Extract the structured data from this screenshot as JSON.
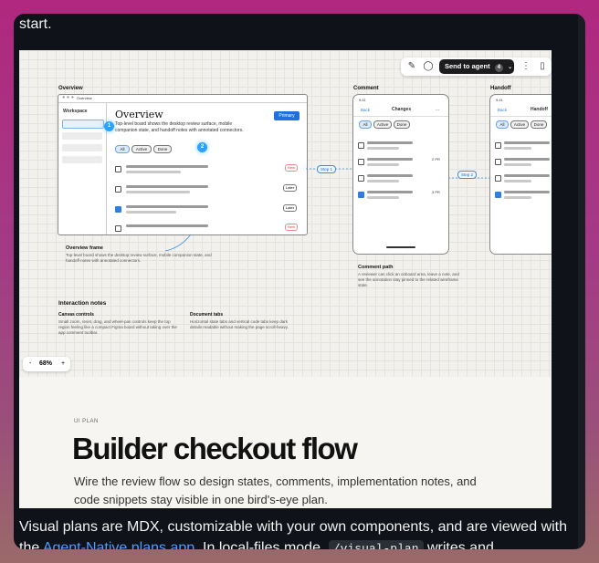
{
  "message": {
    "top_text": "start.",
    "bottom_text_1": "Visual plans are MDX, customizable with your own components, and are viewed",
    "bottom_text_2a": "with the ",
    "bottom_link": "Agent-Native plans app",
    "bottom_text_2b": ". In local-files mode, ",
    "bottom_code": "/visual-plan",
    "bottom_text_2c": " writes and"
  },
  "toolbar": {
    "send_label": "Send to agent",
    "send_count": "4",
    "icons": [
      "pen-icon",
      "comment-icon",
      "chevron-down-icon",
      "more-icon",
      "panel-icon"
    ]
  },
  "canvas": {
    "overview_label": "Overview",
    "comment_label": "Comment",
    "handoff_label": "Handoff",
    "overview_window": {
      "tab": "Overview",
      "sidebar_title": "Workspace",
      "heading": "Overview",
      "description": "Top-level board shows the desktop review surface, mobile companion state, and handoff notes with annotated connectors.",
      "button": "Primary",
      "filters": [
        "All",
        "Active",
        "Done"
      ],
      "row_tags": [
        "New",
        "Later",
        "Later",
        "New"
      ]
    },
    "markers": [
      "1",
      "2"
    ],
    "steps": [
      "Step 1",
      "Step 2"
    ],
    "phone_comment": {
      "time": "9:41",
      "back": "Back",
      "title": "Changes",
      "more": "...",
      "filters": [
        "All",
        "Active",
        "Done"
      ],
      "row_meta": [
        "",
        "2 PR",
        "",
        "3 PR"
      ]
    },
    "phone_handoff": {
      "time": "9:41",
      "back": "Back",
      "title": "Handoff",
      "filters": [
        "All",
        "Active",
        "Done"
      ]
    },
    "overview_frame": {
      "title": "Overview frame",
      "body": "Top-level board shows the desktop review surface, mobile companion state, and handoff notes with annotated connectors."
    },
    "comment_path": {
      "title": "Comment path",
      "body": "A reviewer can click an onboard area, leave a note, and see the annotation stay pinned to the related wireframe state."
    },
    "interaction_notes": {
      "title": "Interaction notes",
      "canvas_controls": {
        "title": "Canvas controls",
        "body": "Small zoom, reset, drag, and wheel-pan controls keep the top region feeling like a compact Figma board without taking over the app comment toolbar."
      },
      "document_tabs": {
        "title": "Document tabs",
        "body": "Horizontal state tabs and vertical code tabs keep dark details readable without making the page scroll-heavy."
      }
    },
    "zoom": {
      "minus": "-",
      "value": "68%",
      "plus": "+"
    }
  },
  "doc": {
    "kicker": "UI PLAN",
    "title": "Builder checkout flow",
    "subtitle": "Wire the review flow so design states, comments, implementation notes, and code snippets stay visible in one bird's-eye plan."
  },
  "colors": {
    "accent": "#29a3ff",
    "primary_button": "#1f6fe0",
    "link": "#4c9cff"
  }
}
